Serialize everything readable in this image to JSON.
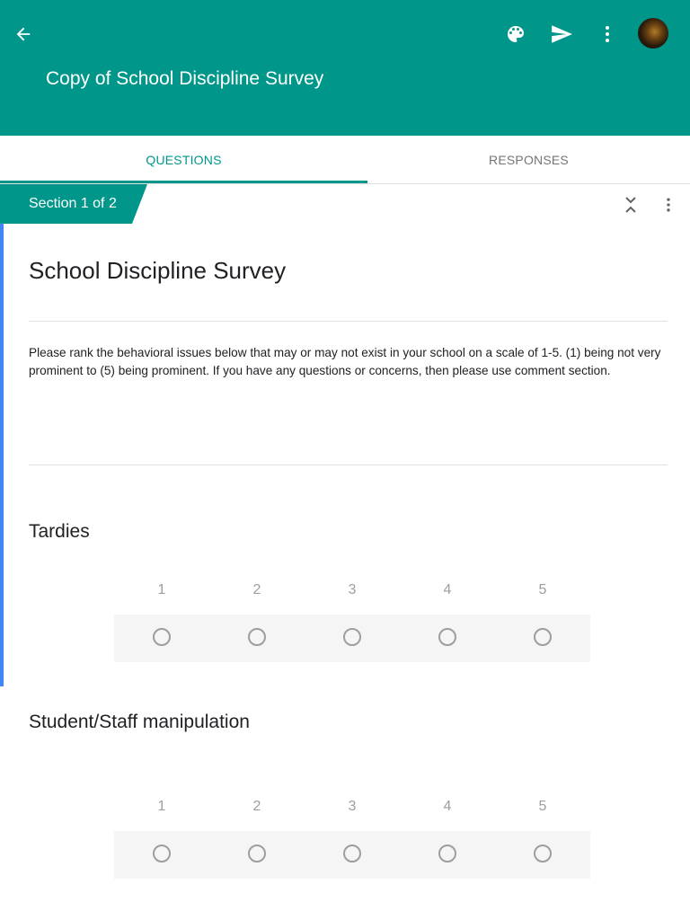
{
  "appbar": {
    "title": "Copy of School Discipline Survey",
    "icons": [
      "back-arrow-icon",
      "palette-icon",
      "send-icon",
      "more-vert-icon",
      "avatar"
    ],
    "color": "#00968a"
  },
  "tabs": [
    {
      "label": "QUESTIONS",
      "active": true
    },
    {
      "label": "RESPONSES",
      "active": false
    }
  ],
  "section": {
    "label": "Section 1 of 2"
  },
  "form": {
    "title": "School Discipline Survey",
    "description": "Please rank the behavioral issues below that may or may not exist in your school on a scale of 1-5. (1) being not very prominent to (5) being prominent. If you have any questions or concerns, then please use comment section."
  },
  "questions": [
    {
      "title": "Tardies",
      "scale": [
        "1",
        "2",
        "3",
        "4",
        "5"
      ]
    },
    {
      "title": "Student/Staff manipulation",
      "scale": [
        "1",
        "2",
        "3",
        "4",
        "5"
      ]
    }
  ],
  "colors": {
    "accent": "#00968a",
    "section_bar": "#4285f4"
  }
}
